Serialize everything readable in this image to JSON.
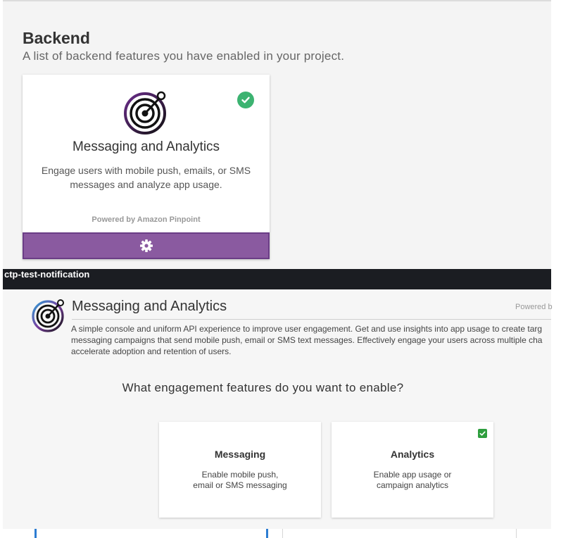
{
  "backend": {
    "title": "Backend",
    "subtitle": "A list of backend features you have enabled in your project."
  },
  "feature_card": {
    "title": "Messaging and Analytics",
    "description_line1": "Engage users with mobile push, emails, or SMS",
    "description_line2": "messages and analyze app usage.",
    "powered_by": "Powered by Amazon Pinpoint",
    "enabled": true,
    "footer_icon": "gear-icon",
    "footer_color": "#8a5aa0"
  },
  "project": {
    "name": "ctp-test-notification"
  },
  "section": {
    "title": "Messaging and Analytics",
    "powered_by": "Powered b",
    "description_lines": [
      "A simple console and uniform API experience to improve user engagement. Get and use insights into app usage to create targ",
      "messaging campaigns that send mobile push, email or SMS text messages. Effectively engage your users across multiple cha",
      "accelerate adoption and retention of users."
    ],
    "question": "What engagement features do you want to enable?"
  },
  "options": [
    {
      "title": "Messaging",
      "desc_line1": "Enable mobile push,",
      "desc_line2": "email or SMS messaging",
      "checked": false
    },
    {
      "title": "Analytics",
      "desc_line1": "Enable app usage or",
      "desc_line2": "campaign analytics",
      "checked": true
    }
  ],
  "colors": {
    "check_green": "#3cb371",
    "dark_bar": "#1b1d22",
    "accent_purple": "#8a5aa0"
  }
}
